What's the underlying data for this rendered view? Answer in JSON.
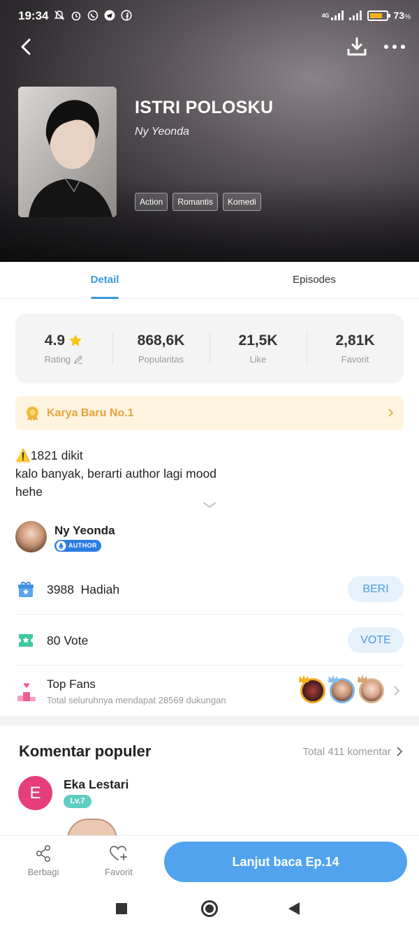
{
  "status_bar": {
    "time": "19:34",
    "network": "4G",
    "battery": "73",
    "battery_unit": "%"
  },
  "header": {
    "back_icon": "chevron-left-icon",
    "download_icon": "download-icon",
    "more_icon": "more-dots-icon"
  },
  "book": {
    "title": "ISTRI POLOSKU",
    "author": "Ny Yeonda",
    "tags": [
      "Action",
      "Romantis",
      "Komedi"
    ]
  },
  "tabs": [
    {
      "label": "Detail",
      "active": true
    },
    {
      "label": "Episodes",
      "active": false
    }
  ],
  "stats": [
    {
      "value": "4.9",
      "label": "Rating"
    },
    {
      "value": "868,6K",
      "label": "Popularitas"
    },
    {
      "value": "21,5K",
      "label": "Like"
    },
    {
      "value": "2,81K",
      "label": "Favorit"
    }
  ],
  "award": {
    "label": "Karya Baru No.1"
  },
  "synopsis": [
    "⚠️1821 dikit",
    "kalo banyak, berarti author lagi mood",
    "hehe"
  ],
  "author_info": {
    "name": "Ny Yeonda",
    "badge": "AUTHOR"
  },
  "gifts": {
    "count": "3988",
    "label": "Hadiah",
    "button": "BERI"
  },
  "votes": {
    "count": "80",
    "label": "Vote",
    "button": "VOTE"
  },
  "top_fans": {
    "title": "Top Fans",
    "subtitle": "Total seluruhnya mendapat 28569 dukungan"
  },
  "comments": {
    "title": "Komentar populer",
    "total": "Total 411 komentar",
    "items": [
      {
        "avatar_letter": "E",
        "name": "Eka Lestari",
        "level": "Lv.7"
      }
    ]
  },
  "bottom_bar": {
    "share": "Berbagi",
    "favorite": "Favorit",
    "continue": "Lanjut baca Ep.14"
  },
  "colors": {
    "accent": "#3a9ad9",
    "primary_button": "#51a3ee",
    "award_text": "#e7a23b",
    "award_bg": "#fff4e0"
  }
}
